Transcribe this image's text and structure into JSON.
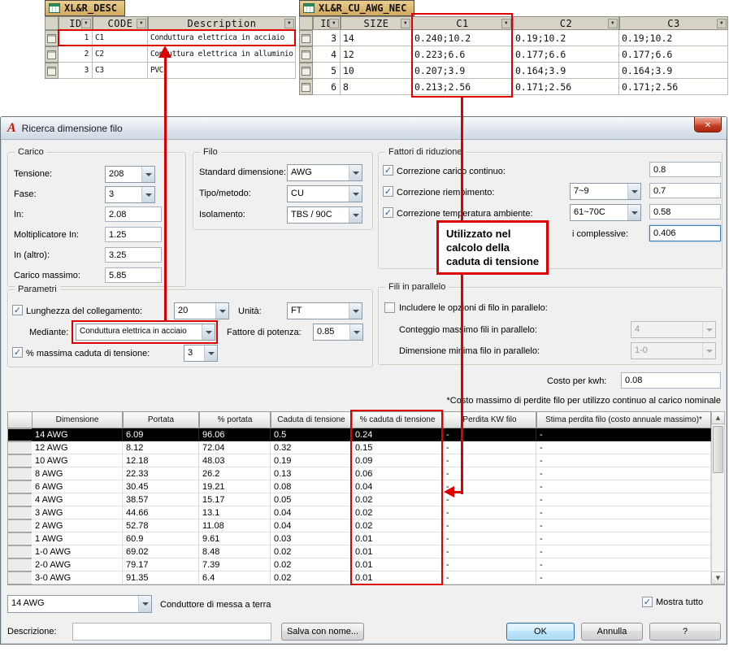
{
  "icons": {
    "app": "A",
    "close": "✕",
    "check": "✓",
    "filter_arrow": "▼",
    "scroll_up": "▲",
    "scroll_down": "▼"
  },
  "colors": {
    "annotation_red": "#dd0000",
    "sheet_tab_gold": "#d2a95e",
    "selected_row": "#000000",
    "dialog_bg": "#f0f0f0"
  },
  "sheet_desc": {
    "title": "XL&R_DESC",
    "headers": [
      "ID",
      "CODE",
      "Description"
    ],
    "rows": [
      [
        "1",
        "C1",
        "Conduttura elettrica in acciaio"
      ],
      [
        "2",
        "C2",
        "Conduttura elettrica in alluminio"
      ],
      [
        "3",
        "C3",
        "PVC"
      ]
    ]
  },
  "sheet_awg": {
    "title": "XL&R_CU_AWG_NEC",
    "headers": [
      "ID",
      "SIZE",
      "C1",
      "C2",
      "C3"
    ],
    "rows": [
      [
        "3",
        "14",
        "0.240;10.2",
        "0.19;10.2",
        "0.19;10.2"
      ],
      [
        "4",
        "12",
        "0.223;6.6",
        "0.177;6.6",
        "0.177;6.6"
      ],
      [
        "5",
        "10",
        "0.207;3.9",
        "0.164;3.9",
        "0.164;3.9"
      ],
      [
        "6",
        "8",
        "0.213;2.56",
        "0.171;2.56",
        "0.171;2.56"
      ]
    ]
  },
  "annotation": {
    "callout": [
      "Utilizzato nel",
      "calcolo della",
      "caduta di tensione"
    ]
  },
  "dialog": {
    "title": "Ricerca dimensione filo",
    "carico": {
      "label": "Carico",
      "tensione_label": "Tensione:",
      "tensione_value": "208",
      "fase_label": "Fase:",
      "fase_value": "3",
      "in_label": "In:",
      "in_value": "2.08",
      "molt_label": "Moltiplicatore In:",
      "molt_value": "1.25",
      "in_altro_label": "In (altro):",
      "in_altro_value": "3.25",
      "carico_massimo_label": "Carico massimo:",
      "carico_massimo_value": "5.85"
    },
    "filo": {
      "label": "Filo",
      "standard_label": "Standard dimensione:",
      "standard_value": "AWG",
      "tipo_label": "Tipo/metodo:",
      "tipo_value": "CU",
      "isolamento_label": "Isolamento:",
      "isolamento_value": "TBS / 90C"
    },
    "fattori": {
      "label": "Fattori di riduzione",
      "carico_continuo_label": "Correzione carico continuo:",
      "carico_continuo_value": "0.8",
      "riempimento_label": "Correzione riempimento:",
      "riempimento_combo": "7~9",
      "riempimento_value": "0.7",
      "temperatura_label": "Correzione temperatura ambiente:",
      "temperatura_combo": "61~70C",
      "temperatura_value": "0.58",
      "complessive_label": "i complessive:",
      "complessive_value": "0.406"
    },
    "parametri": {
      "label": "Parametri",
      "lunghezza_label": "Lunghezza del collegamento:",
      "lunghezza_value": "20",
      "unita_label": "Unità:",
      "unita_value": "FT",
      "mediante_label": "Mediante:",
      "mediante_value": "Conduttura elettrica in acciaio",
      "fattore_potenza_label": "Fattore di potenza:",
      "fattore_potenza_value": "0.85",
      "caduta_label": "% massima caduta di tensione:",
      "caduta_value": "3"
    },
    "parallelo": {
      "label": "Fili in parallelo",
      "include_label": "Includere le opzioni di filo in parallelo:",
      "conteggio_label": "Conteggio massimo fili in parallelo:",
      "conteggio_value": "4",
      "dimensione_label": "Dimensione minima filo in parallelo:",
      "dimensione_value": "1-0"
    },
    "costo_label": "Costo per kwh:",
    "costo_value": "0.08",
    "nota": "*Costo massimo di perdite filo per utilizzo continuo al carico nominale",
    "grid": {
      "headers": [
        "Dimensione",
        "Portata",
        "% portata",
        "Caduta di tensione",
        "% caduta di tensione",
        "Perdita KW filo",
        "Stima perdita filo (costo annuale massimo)*"
      ],
      "selected_index": 0,
      "rows": [
        [
          "14 AWG",
          "6.09",
          "96.06",
          "0.5",
          "0.24",
          "-",
          "-"
        ],
        [
          "12 AWG",
          "8.12",
          "72.04",
          "0.32",
          "0.15",
          "-",
          "-"
        ],
        [
          "10 AWG",
          "12.18",
          "48.03",
          "0.19",
          "0.09",
          "-",
          "-"
        ],
        [
          "8 AWG",
          "22.33",
          "26.2",
          "0.13",
          "0.06",
          "-",
          "-"
        ],
        [
          "6 AWG",
          "30.45",
          "19.21",
          "0.08",
          "0.04",
          "-",
          "-"
        ],
        [
          "4 AWG",
          "38.57",
          "15.17",
          "0.05",
          "0.02",
          "-",
          "-"
        ],
        [
          "3 AWG",
          "44.66",
          "13.1",
          "0.04",
          "0.02",
          "-",
          "-"
        ],
        [
          "2 AWG",
          "52.78",
          "11.08",
          "0.04",
          "0.02",
          "-",
          "-"
        ],
        [
          "1 AWG",
          "60.9",
          "9.61",
          "0.03",
          "0.01",
          "-",
          "-"
        ],
        [
          "1-0 AWG",
          "69.02",
          "8.48",
          "0.02",
          "0.01",
          "-",
          "-"
        ],
        [
          "2-0 AWG",
          "79.17",
          "7.39",
          "0.02",
          "0.01",
          "-",
          "-"
        ],
        [
          "3-0 AWG",
          "91.35",
          "6.4",
          "0.02",
          "0.01",
          "-",
          "-"
        ]
      ]
    },
    "bottom": {
      "size_combo": "14 AWG",
      "messa_terra_label": "Conduttore di messa a terra",
      "mostra_tutto_label": "Mostra tutto",
      "descrizione_label": "Descrizione:",
      "descrizione_value": "",
      "salva_button": "Salva con nome...",
      "ok_button": "OK",
      "annulla_button": "Annulla",
      "help_button": "?"
    }
  }
}
